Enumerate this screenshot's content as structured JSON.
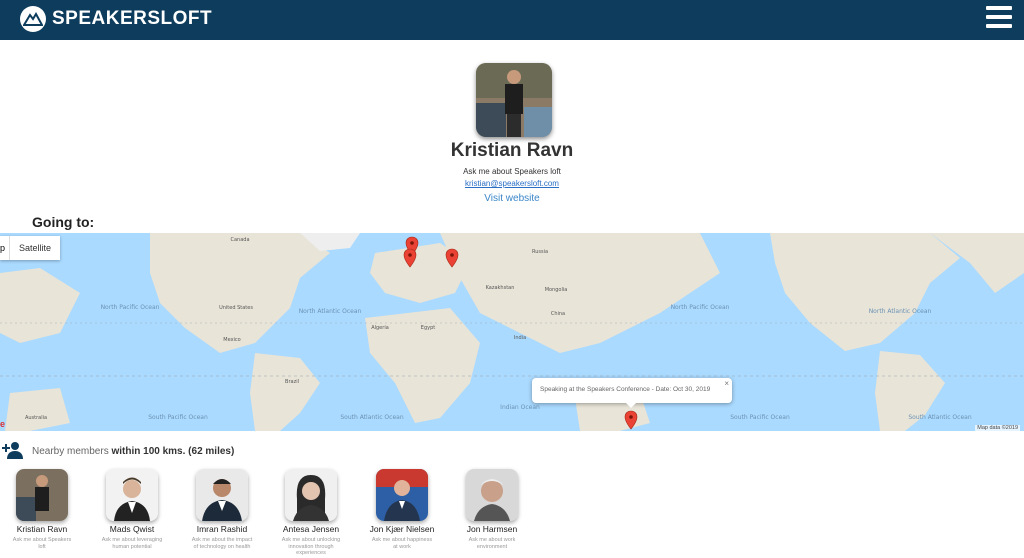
{
  "header": {
    "brand": "SPEAKERSLOFT",
    "menu_icon": "hamburger-icon",
    "bg_color": "#0d3c5c"
  },
  "profile": {
    "name": "Kristian Ravn",
    "about": "Ask me about Speakers loft",
    "email": "kristian@speakersloft.com",
    "website_label": "Visit website"
  },
  "going_to": {
    "heading": "Going to:"
  },
  "map": {
    "type_tab_left": "p",
    "type_tab_satellite": "Satellite",
    "info_window": "Speaking at the Speakers Conference - Date: Oct 30, 2019",
    "info_close": "×",
    "attribution": "Map data ©2019",
    "google_fragment": "e",
    "labels": {
      "north_pacific_1": "North Pacific Ocean",
      "north_atlantic_1": "North Atlantic Ocean",
      "south_pacific_1": "South Pacific Ocean",
      "south_atlantic_1": "South Atlantic Ocean",
      "indian_ocean": "Indian Ocean",
      "north_pacific_2": "North Pacific Ocean",
      "north_atlantic_2": "North Atlantic Ocean",
      "south_pacific_2": "South Pacific Ocean",
      "south_atlantic_2": "South Atlantic Ocean",
      "united_states": "United States",
      "brazil": "Brazil",
      "russia": "Russia",
      "china": "China",
      "india": "India",
      "australia": "Australia",
      "kazakhstan": "Kazakhstan",
      "mongolia": "Mongolia",
      "algeria": "Algeria",
      "egypt": "Egypt",
      "canada": "Canada",
      "mexico": "Mexico"
    }
  },
  "nearby": {
    "icon": "add-person-icon",
    "prefix": "Nearby members",
    "bold": "within 100 kms. (62 miles)"
  },
  "members": [
    {
      "name": "Kristian Ravn",
      "about": "Ask me about Speakers loft"
    },
    {
      "name": "Mads Qwist",
      "about": "Ask me about leveraging human potential"
    },
    {
      "name": "Imran Rashid",
      "about": "Ask me about the impact of technology on health"
    },
    {
      "name": "Antesa Jensen",
      "about": "Ask me about unlocking innovation through experiences"
    },
    {
      "name": "Jon Kjær Nielsen",
      "about": "Ask me about happiness at work"
    },
    {
      "name": "Jon Harmsen",
      "about": "Ask me about work environment"
    }
  ]
}
